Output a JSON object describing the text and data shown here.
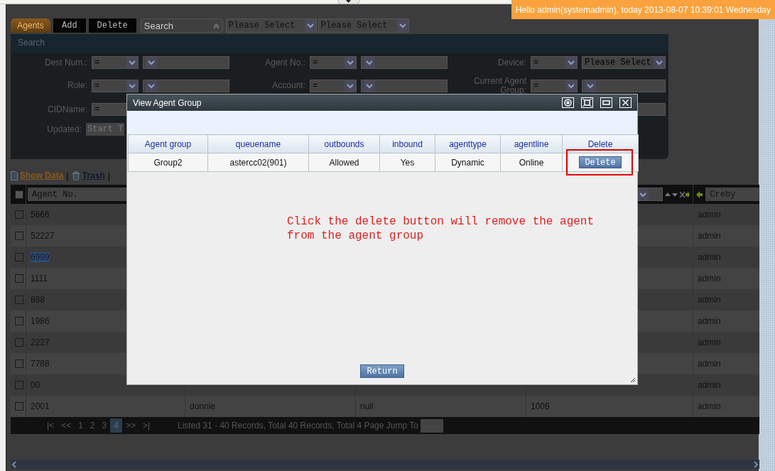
{
  "greeting": "Hello admin(systemadmin), today 2013-08-07 10:39:01 Wednesday",
  "toolbar": {
    "tabs": [
      {
        "label": "Agents",
        "selected": true
      }
    ],
    "buttons": [
      "Add",
      "Delete"
    ],
    "search_select": "Search",
    "selects": [
      "Please Select",
      "Please Select"
    ]
  },
  "search_panel": {
    "title": "Search",
    "rows": [
      {
        "fields": [
          {
            "kind": "pair",
            "label": "Dest Num.:",
            "operator": "="
          },
          {
            "kind": "pair",
            "label": "Agent No.:",
            "operator": "="
          },
          {
            "kind": "pair",
            "label": "Device:",
            "operator": "=",
            "value": "Please Select"
          }
        ]
      },
      {
        "fields": [
          {
            "kind": "pair",
            "label": "Role:",
            "operator": "="
          },
          {
            "kind": "pair",
            "label": "Account:",
            "operator": "="
          },
          {
            "kind": "pair",
            "label": "Current Agent Group:",
            "operator": "="
          }
        ]
      },
      {
        "fields": [
          {
            "kind": "operator",
            "label": "CIDName:",
            "operator": "="
          },
          {
            "kind": "input"
          }
        ]
      },
      {
        "fields": [
          {
            "kind": "text",
            "label": "Updated:",
            "placeholder": "Start T"
          }
        ]
      }
    ]
  },
  "links": [
    {
      "kind": "show-data",
      "label": "Show Data"
    },
    {
      "kind": "separator",
      "label": "|"
    },
    {
      "kind": "trash",
      "label": "Trash"
    },
    {
      "kind": "separator",
      "label": "|"
    }
  ],
  "table": {
    "header": {
      "checked": false,
      "agent_no": "Agent No.",
      "creby": "Creby"
    },
    "rows": [
      {
        "checked": false,
        "highlighted": false,
        "agent_no": "5666",
        "creby": "admin"
      },
      {
        "checked": false,
        "highlighted": false,
        "agent_no": "52227",
        "creby": "admin"
      },
      {
        "checked": false,
        "highlighted": true,
        "agent_no": "6999",
        "creby": "admin"
      },
      {
        "checked": false,
        "highlighted": false,
        "agent_no": "1111",
        "creby": "admin"
      },
      {
        "checked": false,
        "highlighted": false,
        "agent_no": "888",
        "creby": "admin"
      },
      {
        "checked": false,
        "highlighted": false,
        "agent_no": "1986",
        "creby": "admin"
      },
      {
        "checked": false,
        "highlighted": false,
        "agent_no": "2227",
        "creby": "admin"
      },
      {
        "checked": false,
        "highlighted": false,
        "agent_no": "7788",
        "creby": "admin"
      },
      {
        "checked": false,
        "highlighted": false,
        "agent_no": "00",
        "creby": "admin"
      },
      {
        "checked": false,
        "highlighted": false,
        "agent_no": "2001",
        "column_2": "donnie",
        "column_3": "null",
        "column_4": "1008",
        "creby": "admin"
      }
    ]
  },
  "pagination": {
    "items": [
      {
        "label": "|<",
        "selected": false
      },
      {
        "label": "<<",
        "selected": false
      },
      {
        "label": "1",
        "selected": false
      },
      {
        "label": "2",
        "selected": false
      },
      {
        "label": "3",
        "selected": false
      },
      {
        "label": "4",
        "selected": true
      },
      {
        "label": ">>",
        "selected": false
      },
      {
        "label": ">|",
        "selected": false
      }
    ],
    "info": "Listed 31 - 40 Records, Total 40 Records, Total 4 Page Jump To"
  },
  "dialog": {
    "title": "View Agent Group",
    "columns": [
      "Agent group",
      "queuename",
      "outbounds",
      "inbound",
      "agenttype",
      "agentline",
      "Delete"
    ],
    "rows": [
      {
        "cells": [
          "Group2",
          "astercc02(901)",
          "Allowed",
          "Yes",
          "Dynamic",
          "Online"
        ],
        "action": "Delete",
        "highlighted": true
      }
    ],
    "note": "Click the delete button will remove the agent from the agent group",
    "return_button": "Return"
  }
}
